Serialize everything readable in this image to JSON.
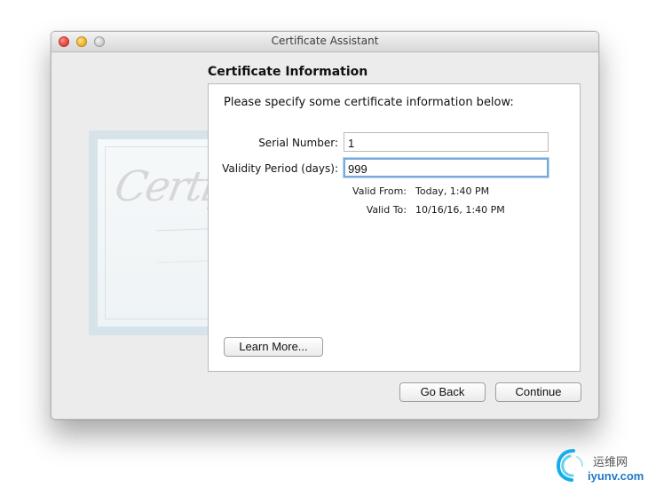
{
  "window": {
    "title": "Certificate Assistant"
  },
  "content": {
    "section_title": "Certificate Information",
    "instructions": "Please specify some certificate information below:",
    "fields": {
      "serial_number": {
        "label": "Serial Number:",
        "value": "1"
      },
      "validity_period": {
        "label": "Validity Period (days):",
        "value": "999"
      }
    },
    "validity": {
      "from_label": "Valid From:",
      "from_value": "Today, 1:40 PM",
      "to_label": "Valid To:",
      "to_value": "10/16/16, 1:40 PM"
    },
    "background_art_text": "Certificate"
  },
  "buttons": {
    "learn_more": "Learn More...",
    "go_back": "Go Back",
    "continue": "Continue"
  },
  "watermark": {
    "cn": "运维网",
    "en": "iyunv.com"
  },
  "colors": {
    "focus_ring": "#79a8dc",
    "close": "#f0524a",
    "minimize": "#f5bd33",
    "zoom_inactive": "#cfcfcf",
    "watermark_blue": "#1f77c7"
  }
}
